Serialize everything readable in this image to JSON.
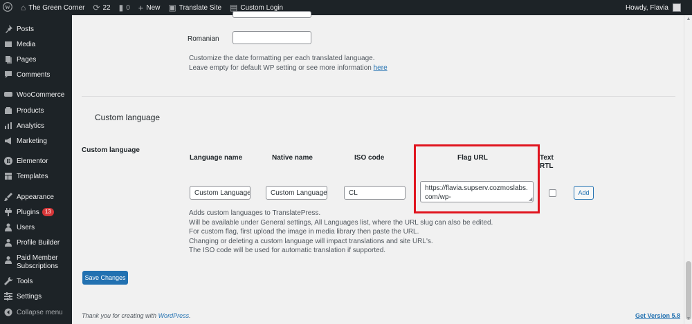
{
  "adminbar": {
    "site_name": "The Green Corner",
    "updates_count": "22",
    "comments_count": "0",
    "new_label": "New",
    "translate_label": "Translate Site",
    "custom_login_label": "Custom Login",
    "howdy": "Howdy, Flavia"
  },
  "sidebar": {
    "items": [
      {
        "label": "Posts",
        "icon": "pin-icon"
      },
      {
        "label": "Media",
        "icon": "media-icon"
      },
      {
        "label": "Pages",
        "icon": "pages-icon"
      },
      {
        "label": "Comments",
        "icon": "comments-icon"
      },
      {
        "label": "WooCommerce",
        "icon": "woocommerce-icon"
      },
      {
        "label": "Products",
        "icon": "products-icon"
      },
      {
        "label": "Analytics",
        "icon": "analytics-icon"
      },
      {
        "label": "Marketing",
        "icon": "megaphone-icon"
      },
      {
        "label": "Elementor",
        "icon": "elementor-icon"
      },
      {
        "label": "Templates",
        "icon": "templates-icon"
      },
      {
        "label": "Appearance",
        "icon": "brush-icon"
      },
      {
        "label": "Plugins",
        "icon": "plugin-icon",
        "badge": "13"
      },
      {
        "label": "Users",
        "icon": "users-icon"
      },
      {
        "label": "Profile Builder",
        "icon": "profile-icon"
      },
      {
        "label": "Paid Member Subscriptions",
        "icon": "member-icon"
      },
      {
        "label": "Tools",
        "icon": "wrench-icon"
      },
      {
        "label": "Settings",
        "icon": "settings-icon"
      }
    ],
    "collapse_label": "Collapse menu"
  },
  "date_format": {
    "romanian_label": "Romanian",
    "romanian_value": "",
    "desc_line1": "Customize the date formatting per each translated language.",
    "desc_line2": "Leave empty for default WP setting or see more information ",
    "desc_link": "here"
  },
  "custom_language": {
    "section_title": "Custom language",
    "row_label": "Custom language",
    "col_language_name": "Language name",
    "col_native_name": "Native name",
    "col_iso_code": "ISO code",
    "col_flag_url": "Flag URL",
    "col_text_rtl_1": "Text",
    "col_text_rtl_2": "RTL",
    "language_name_value": "Custom Language",
    "native_name_value": "Custom Language",
    "iso_code_value": "CL",
    "flag_url_value": "https://flavia.supserv.cozmoslabs.com/wp-",
    "add_button": "Add",
    "desc": [
      "Adds custom languages to TranslatePress.",
      "Will be available under General settings, All Languages list, where the URL slug can also be edited.",
      "For custom flag, first upload the image in media library then paste the URL.",
      "Changing or deleting a custom language will impact translations and site URL's.",
      "The ISO code will be used for automatic translation if supported."
    ]
  },
  "save_button": "Save Changes",
  "footer": {
    "thanks_prefix": "Thank you for creating with ",
    "wp_link": "WordPress",
    "thanks_suffix": ".",
    "version": "Get Version 5.8"
  },
  "colors": {
    "sidebar_bg": "#1d2327",
    "accent": "#2271b1",
    "highlight_border": "#e0141e",
    "badge": "#d63638"
  }
}
